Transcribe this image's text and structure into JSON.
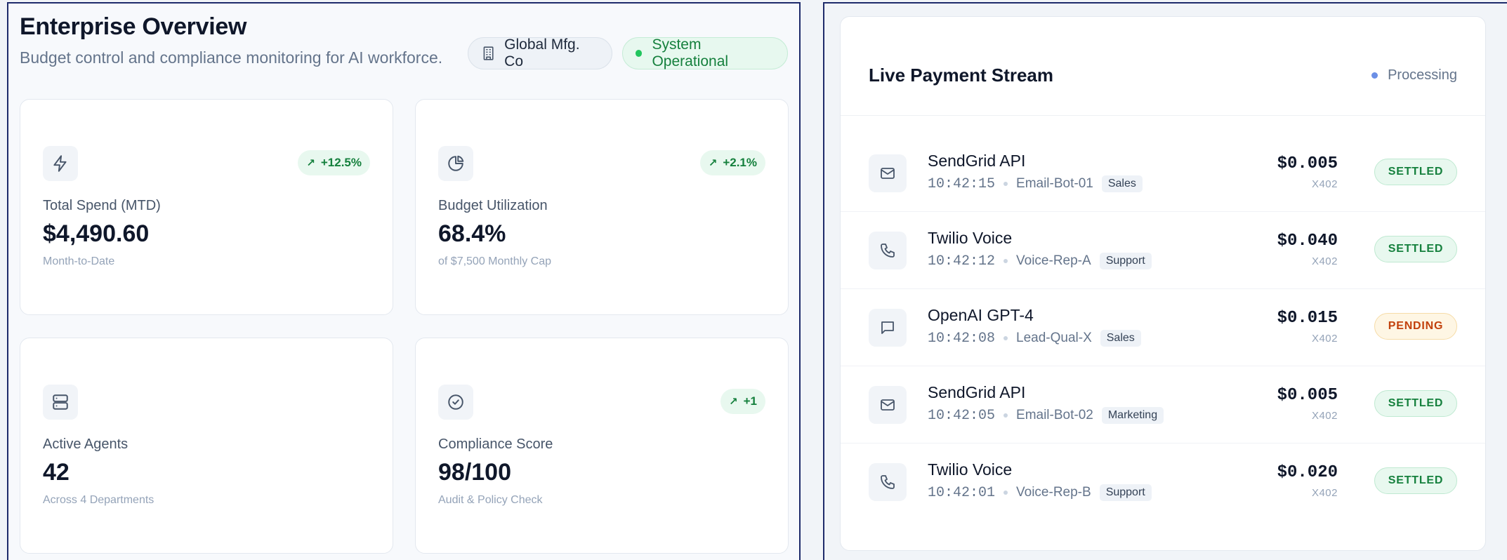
{
  "overview": {
    "title": "Enterprise Overview",
    "subtitle": "Budget control and compliance monitoring for AI workforce.",
    "org_name": "Global Mfg. Co",
    "system_status": "System Operational"
  },
  "metrics": [
    {
      "icon": "lightning-icon",
      "trend": "+12.5%",
      "label": "Total Spend (MTD)",
      "value": "$4,490.60",
      "sub": "Month-to-Date"
    },
    {
      "icon": "pie-chart-icon",
      "trend": "+2.1%",
      "label": "Budget Utilization",
      "value": "68.4%",
      "sub": "of $7,500 Monthly Cap"
    },
    {
      "icon": "server-icon",
      "trend": "",
      "label": "Active Agents",
      "value": "42",
      "sub": "Across 4 Departments"
    },
    {
      "icon": "check-circle-icon",
      "trend": "+1",
      "label": "Compliance Score",
      "value": "98/100",
      "sub": "Audit & Policy Check"
    }
  ],
  "stream": {
    "title": "Live Payment Stream",
    "status": "Processing",
    "rows": [
      {
        "icon": "mail-icon",
        "name": "SendGrid API",
        "time": "10:42:15",
        "agent": "Email-Bot-01",
        "dept": "Sales",
        "amount": "$0.005",
        "protocol": "X402",
        "status": "SETTLED"
      },
      {
        "icon": "phone-icon",
        "name": "Twilio Voice",
        "time": "10:42:12",
        "agent": "Voice-Rep-A",
        "dept": "Support",
        "amount": "$0.040",
        "protocol": "X402",
        "status": "SETTLED"
      },
      {
        "icon": "chat-icon",
        "name": "OpenAI GPT-4",
        "time": "10:42:08",
        "agent": "Lead-Qual-X",
        "dept": "Sales",
        "amount": "$0.015",
        "protocol": "X402",
        "status": "PENDING"
      },
      {
        "icon": "mail-icon",
        "name": "SendGrid API",
        "time": "10:42:05",
        "agent": "Email-Bot-02",
        "dept": "Marketing",
        "amount": "$0.005",
        "protocol": "X402",
        "status": "SETTLED"
      },
      {
        "icon": "phone-icon",
        "name": "Twilio Voice",
        "time": "10:42:01",
        "agent": "Voice-Rep-B",
        "dept": "Support",
        "amount": "$0.020",
        "protocol": "X402",
        "status": "SETTLED"
      }
    ]
  },
  "colors": {
    "accent_border": "#1e2b6b",
    "success": "#15803d",
    "warning": "#c2410c",
    "processing": "#6b8fe6"
  }
}
